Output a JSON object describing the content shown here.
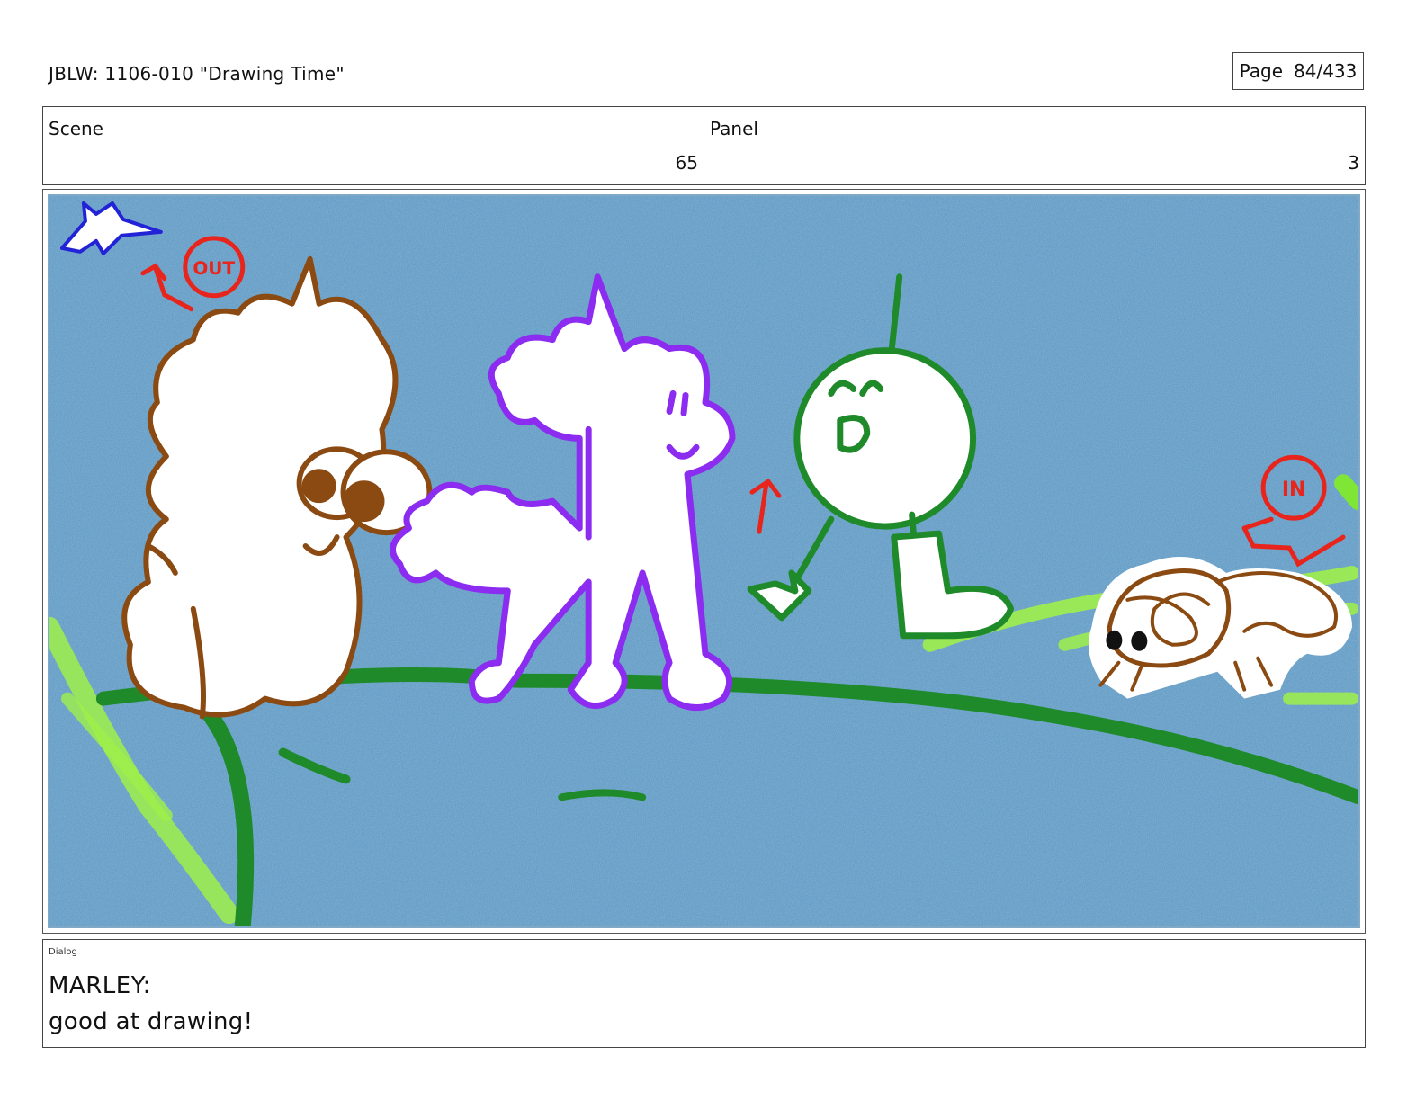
{
  "header": {
    "title": "JBLW: 1106-010 \"Drawing Time\""
  },
  "page": {
    "label": "Page",
    "value": "84/433"
  },
  "scene": {
    "label": "Scene",
    "value": "65"
  },
  "panel": {
    "label": "Panel",
    "value": "3"
  },
  "frame": {
    "background_color": "#4f97c4",
    "annotations": {
      "out_label": "OUT",
      "in_label": "IN"
    },
    "colors": {
      "brown": "#8a4a12",
      "purple": "#8b2cf0",
      "green": "#1f8a2a",
      "lime": "#7fe635",
      "red": "#e8251c",
      "blue": "#2222d6"
    },
    "icons": [
      "airplane-icon",
      "unicorn-bear-character",
      "unicorn-poodle-character",
      "stick-figure-character",
      "hamster-character"
    ]
  },
  "dialog": {
    "label": "Dialog",
    "speaker": "MARLEY:",
    "line": "good at drawing!"
  }
}
